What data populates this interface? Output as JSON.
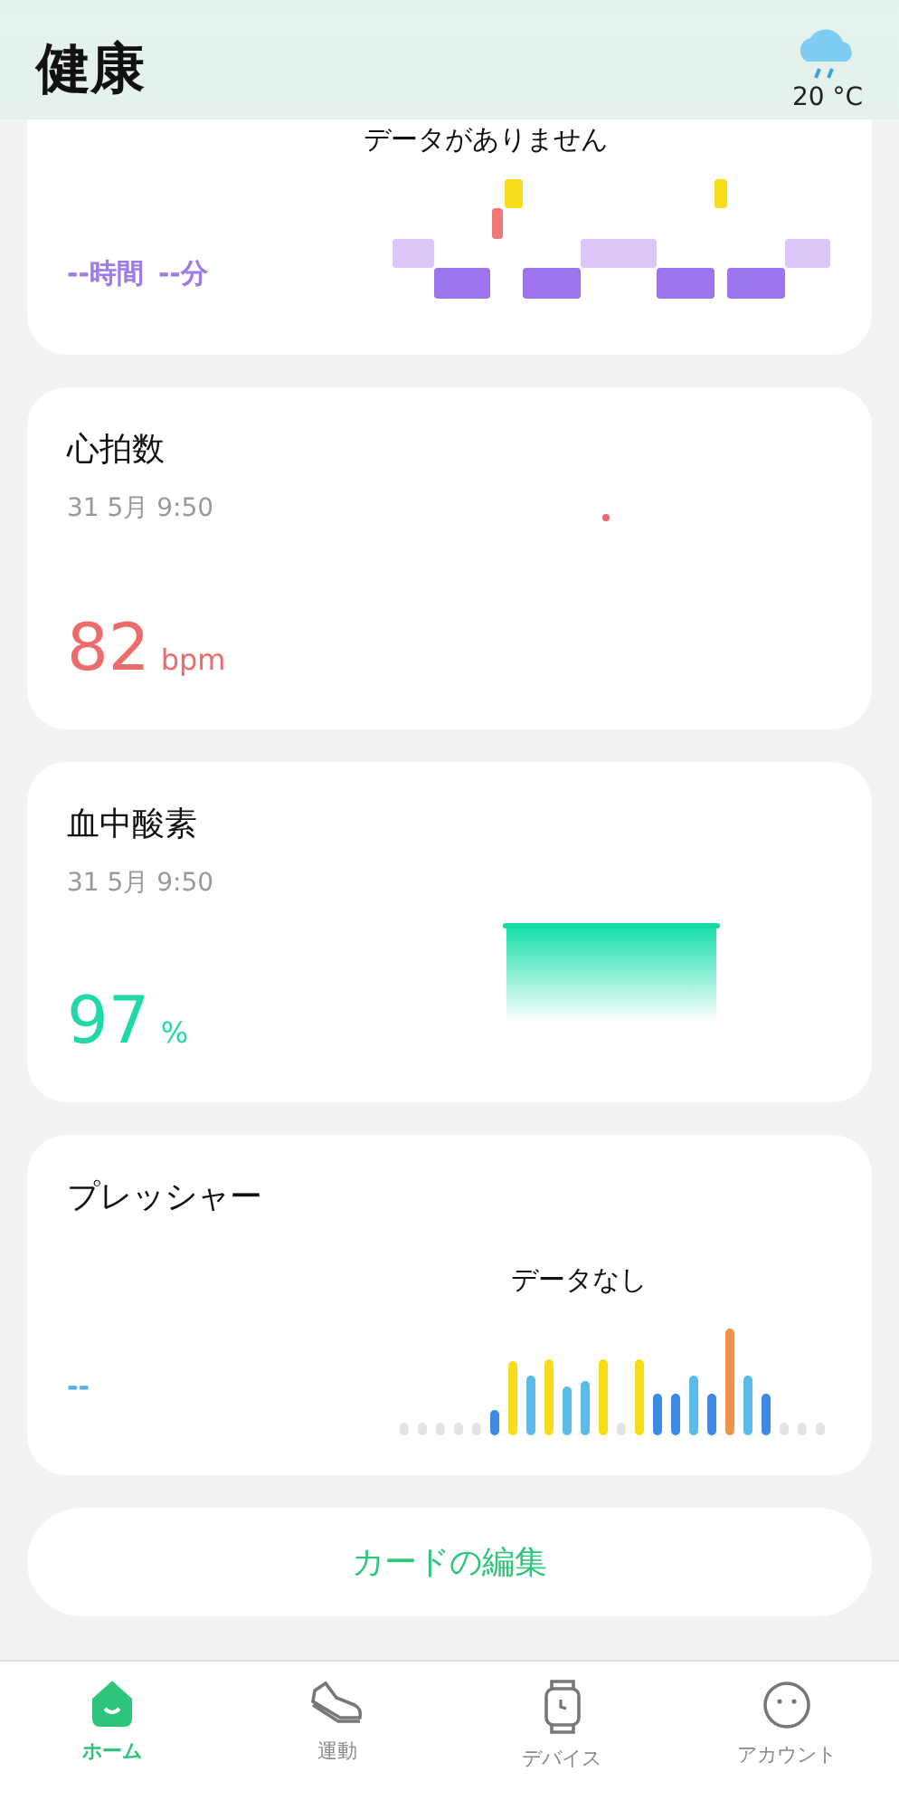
{
  "header": {
    "title": "健康",
    "weather": {
      "temperature": "20 °C"
    }
  },
  "sleep": {
    "message": "データがありません",
    "hours": "--時間",
    "minutes": "--分"
  },
  "heart_rate": {
    "title": "心拍数",
    "time": "31 5月 9:50",
    "value": "82",
    "unit": "bpm"
  },
  "blood_oxygen": {
    "title": "血中酸素",
    "time": "31 5月 9:50",
    "value": "97",
    "unit": "%"
  },
  "pressure": {
    "title": "プレッシャー",
    "message": "データなし",
    "value": "--"
  },
  "edit_cards_button": "カードの編集",
  "nav": [
    {
      "label": "ホーム",
      "kind": "home",
      "selected": true
    },
    {
      "label": "運動",
      "kind": "shoe",
      "selected": false
    },
    {
      "label": "デバイス",
      "kind": "watch",
      "selected": false
    },
    {
      "label": "アカウント",
      "kind": "face",
      "selected": false
    }
  ]
}
